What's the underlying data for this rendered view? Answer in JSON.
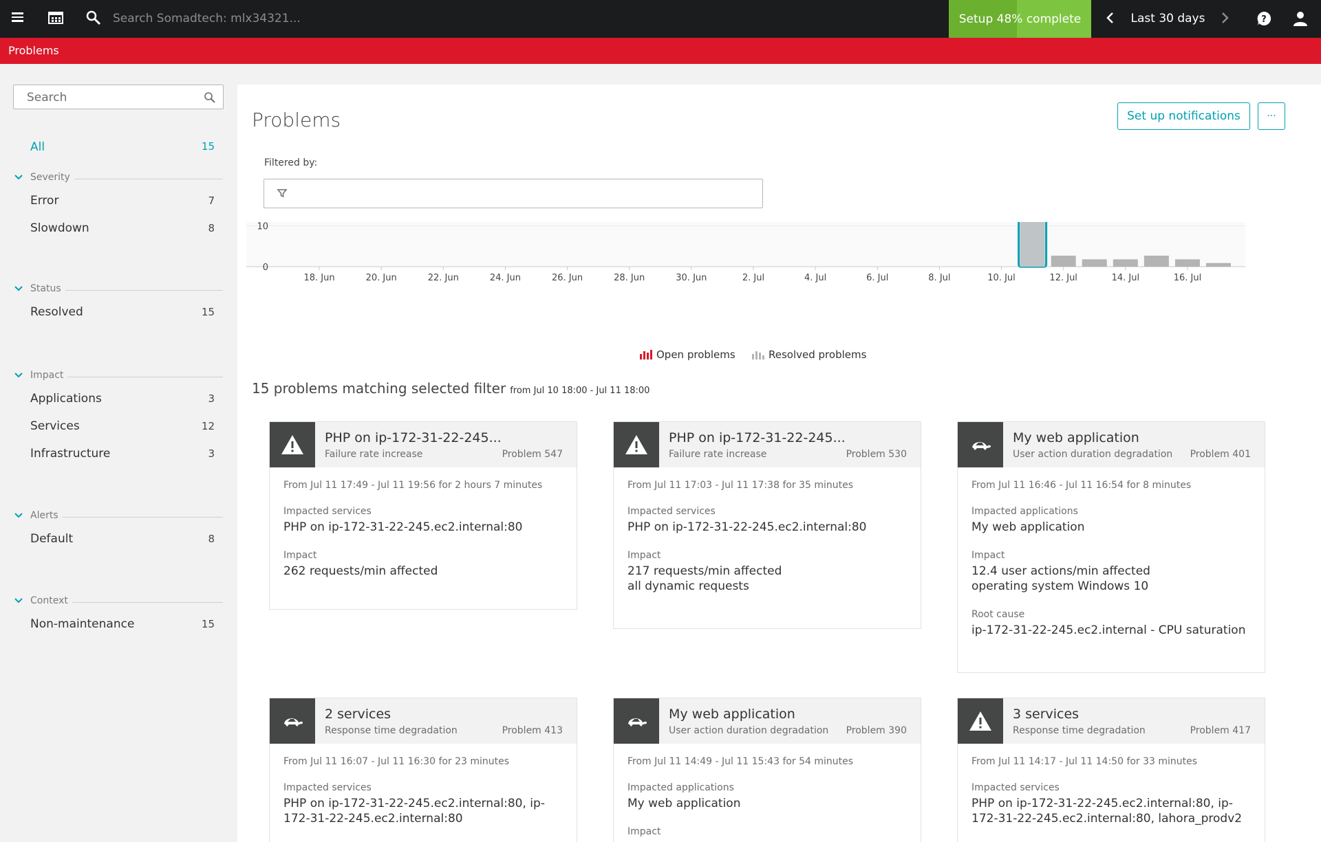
{
  "topbar": {
    "search_placeholder": "Search Somadtech: mlx34321...",
    "setup_label": "Setup 48% complete",
    "setup_percent": 48,
    "timeframe": "Last 30 days"
  },
  "breadcrumb": "Problems",
  "sidebar": {
    "search_placeholder": "Search",
    "all": {
      "label": "All",
      "count": "15"
    },
    "groups": [
      {
        "title": "Severity",
        "items": [
          {
            "label": "Error",
            "count": "7"
          },
          {
            "label": "Slowdown",
            "count": "8"
          }
        ]
      },
      {
        "title": "Status",
        "items": [
          {
            "label": "Resolved",
            "count": "15"
          }
        ]
      },
      {
        "title": "Impact",
        "items": [
          {
            "label": "Applications",
            "count": "3"
          },
          {
            "label": "Services",
            "count": "12"
          },
          {
            "label": "Infrastructure",
            "count": "3"
          }
        ]
      },
      {
        "title": "Alerts",
        "items": [
          {
            "label": "Default",
            "count": "8"
          }
        ]
      },
      {
        "title": "Context",
        "items": [
          {
            "label": "Non-maintenance",
            "count": "15"
          }
        ]
      }
    ]
  },
  "main": {
    "title": "Problems",
    "notify_label": "Set up notifications",
    "more_label": "···",
    "filtered_label": "Filtered by:",
    "match_text": "15 problems matching selected filter",
    "match_range": "from Jul 10 18:00 - Jul 11 18:00"
  },
  "colors": {
    "accent": "#00a1b2",
    "brand_red": "#dc172a",
    "setup_green": "#7dc540",
    "open": "#dc172a",
    "resolved": "#b4b4b4"
  },
  "chart_data": {
    "type": "bar",
    "title": "",
    "y_ticks": [
      "0",
      "10",
      "20"
    ],
    "ylim": [
      0,
      20
    ],
    "x_tick_labels": [
      "18. Jun",
      "20. Jun",
      "22. Jun",
      "24. Jun",
      "26. Jun",
      "28. Jun",
      "30. Jun",
      "2. Jul",
      "4. Jul",
      "6. Jul",
      "8. Jul",
      "10. Jul",
      "12. Jul",
      "14. Jul",
      "16. Jul"
    ],
    "categories": [
      "11. Jul",
      "12. Jul",
      "13. Jul",
      "14. Jul",
      "15. Jul",
      "16. Jul",
      "17. Jul"
    ],
    "series": [
      {
        "name": "Open problems",
        "values": [
          0,
          0,
          0,
          0,
          0,
          0,
          0
        ]
      },
      {
        "name": "Resolved problems",
        "values": [
          15,
          2.7,
          1.8,
          1.8,
          2.7,
          1.8,
          0.9
        ]
      }
    ],
    "selected_category": "11. Jul",
    "legend": [
      "Open problems",
      "Resolved problems"
    ],
    "legend_position": "bottom",
    "grid": true
  },
  "cards": [
    {
      "icon": "warning-icon",
      "title": "PHP on ip-172-31-22-245...",
      "subtitle": "Failure rate increase",
      "number": "Problem 547",
      "range": "From Jul 11 17:49 - Jul 11 19:56 for 2 hours 7 minutes",
      "sections": [
        {
          "label": "Impacted services",
          "lines": [
            "PHP on ip-172-31-22-245.ec2.internal:80"
          ]
        },
        {
          "label": "Impact",
          "lines": [
            "262 requests/min affected"
          ]
        }
      ]
    },
    {
      "icon": "warning-icon",
      "title": "PHP on ip-172-31-22-245...",
      "subtitle": "Failure rate increase",
      "number": "Problem 530",
      "range": "From Jul 11 17:03 - Jul 11 17:38 for 35 minutes",
      "sections": [
        {
          "label": "Impacted services",
          "lines": [
            "PHP on ip-172-31-22-245.ec2.internal:80"
          ]
        },
        {
          "label": "Impact",
          "lines": [
            "217 requests/min affected",
            "all dynamic requests"
          ]
        }
      ]
    },
    {
      "icon": "turtle-icon",
      "title": "My web application",
      "subtitle": "User action duration degradation",
      "number": "Problem 401",
      "range": "From Jul 11 16:46 - Jul 11 16:54 for 8 minutes",
      "sections": [
        {
          "label": "Impacted applications",
          "lines": [
            "My web application"
          ]
        },
        {
          "label": "Impact",
          "lines": [
            "12.4 user actions/min affected",
            "operating system Windows 10"
          ]
        },
        {
          "label": "Root cause",
          "lines": [
            "ip-172-31-22-245.ec2.internal - CPU saturation"
          ]
        }
      ]
    },
    {
      "icon": "turtle-icon",
      "title": "2 services",
      "subtitle": "Response time degradation",
      "number": "Problem 413",
      "range": "From Jul 11 16:07 - Jul 11 16:30 for 23 minutes",
      "sections": [
        {
          "label": "Impacted services",
          "lines": [
            "PHP on ip-172-31-22-245.ec2.internal:80, ip-172-31-22-245.ec2.internal:80"
          ]
        }
      ]
    },
    {
      "icon": "turtle-icon",
      "title": "My web application",
      "subtitle": "User action duration degradation",
      "number": "Problem 390",
      "range": "From Jul 11 14:49 - Jul 11 15:43 for 54 minutes",
      "sections": [
        {
          "label": "Impacted applications",
          "lines": [
            "My web application"
          ]
        },
        {
          "label": "Impact",
          "lines": []
        }
      ]
    },
    {
      "icon": "warning-icon",
      "title": "3 services",
      "subtitle": "Response time degradation",
      "number": "Problem 417",
      "range": "From Jul 11 14:17 - Jul 11 14:50 for 33 minutes",
      "sections": [
        {
          "label": "Impacted services",
          "lines": [
            "PHP on ip-172-31-22-245.ec2.internal:80, ip-172-31-22-245.ec2.internal:80, lahora_prodv2"
          ]
        }
      ]
    }
  ]
}
